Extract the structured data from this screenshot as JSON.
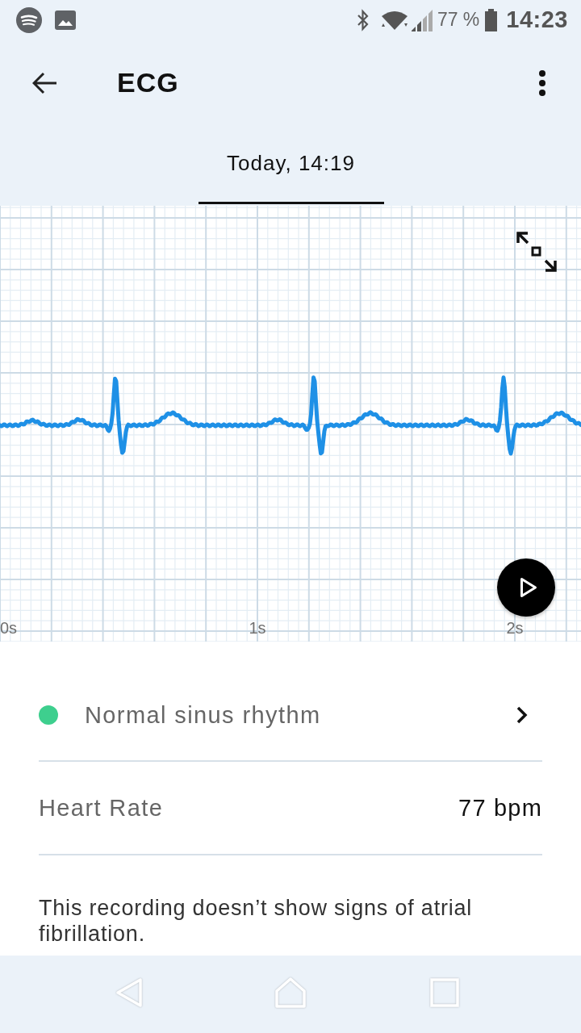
{
  "status_bar": {
    "battery_text": "77 %",
    "time": "14:23"
  },
  "app_bar": {
    "title": "ECG"
  },
  "tabs": [
    {
      "label": "Today, 14:19",
      "selected": true
    }
  ],
  "ecg_chart": {
    "time_labels": [
      "0s",
      "1s",
      "2s"
    ]
  },
  "result": {
    "label": "Normal sinus rhythm",
    "color": "#3ecf8e"
  },
  "heart_rate": {
    "label": "Heart Rate",
    "value": "77 bpm"
  },
  "description": "This recording doesn’t show signs of atrial fibrillation."
}
